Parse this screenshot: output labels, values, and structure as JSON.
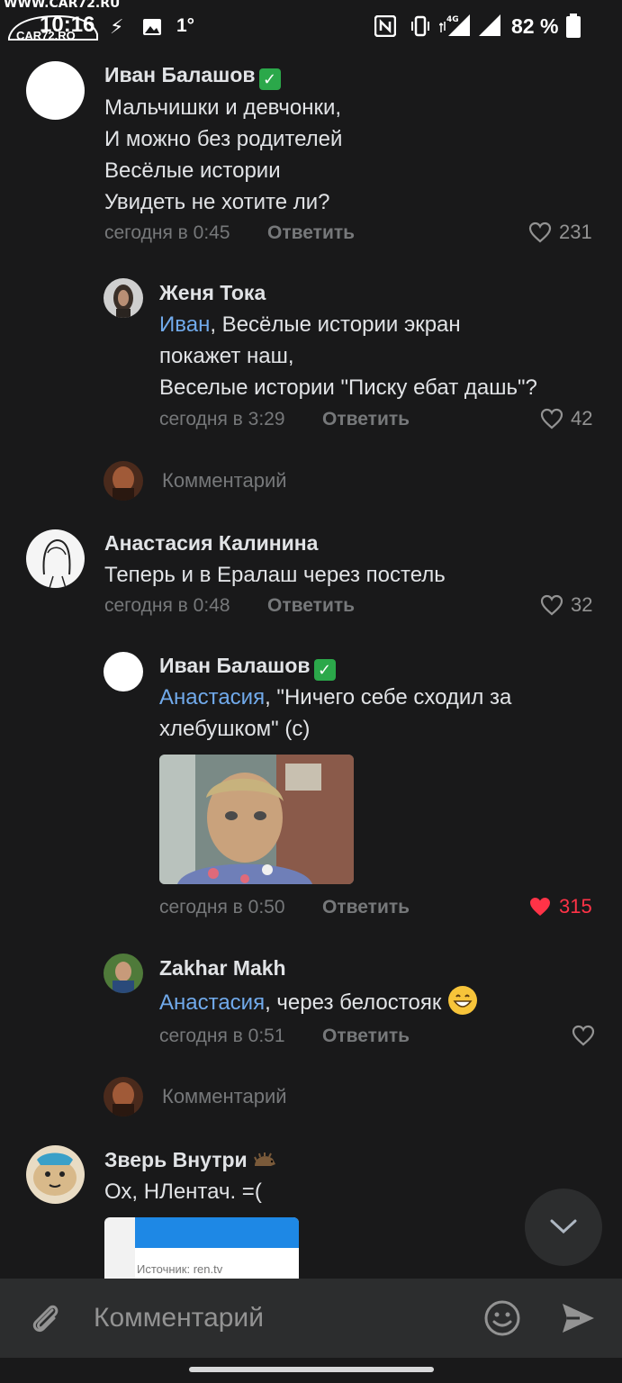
{
  "status_bar": {
    "watermark": "WWW.CAR72.RU",
    "logo_text": "CAR72.RO",
    "time": "10:16",
    "temperature": "1°",
    "battery": "82 %"
  },
  "comments": [
    {
      "author": "Иван Балашов",
      "lines": [
        "Мальчишки и девчонки,",
        "И можно без родителей",
        "Весёлые истории",
        "Увидеть не хотите ли?"
      ],
      "time": "сегодня в 0:45",
      "reply": "Ответить",
      "likes": "231"
    },
    {
      "author": "Женя Тока",
      "mention": "Иван",
      "line1_rest": ", Весёлые истории экран",
      "lines": [
        "покажет наш,",
        "Веселые истории \"Писку ебат дашь\"?"
      ],
      "time": "сегодня в 3:29",
      "reply": "Ответить",
      "likes": "42"
    },
    {
      "author": "Анастасия Калинина",
      "lines": [
        "Теперь и в Ералаш через постель"
      ],
      "time": "сегодня в 0:48",
      "reply": "Ответить",
      "likes": "32"
    },
    {
      "author": "Иван Балашов",
      "mention": "Анастасия",
      "line1_rest": ", \"Ничего себе сходил за",
      "lines": [
        "хлебушком\" (с)"
      ],
      "time": "сегодня в 0:50",
      "reply": "Ответить",
      "likes": "315"
    },
    {
      "author": "Zakhar Makh",
      "mention": "Анастасия",
      "line1_rest": ", через белостояк",
      "time": "сегодня в 0:51",
      "reply": "Ответить"
    },
    {
      "author": "Зверь Внутри",
      "lines": [
        "Ох, НЛентач. =("
      ],
      "attachment_caption": "Источник: ren.tv"
    }
  ],
  "comment_prompt": "Комментарий",
  "composer": {
    "placeholder": "Комментарий"
  },
  "colors": {
    "background": "#19191a",
    "mention": "#71aaeb",
    "like_active": "#ff3347",
    "verified": "#2ba84a"
  }
}
